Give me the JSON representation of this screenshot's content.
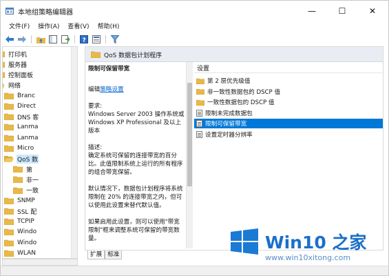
{
  "window": {
    "title": "本地组策略编辑器",
    "controls": {
      "minimize": "—",
      "maximize": "☐",
      "close": "✕"
    }
  },
  "menu": [
    "文件(F)",
    "操作(A)",
    "查看(V)",
    "帮助(H)"
  ],
  "toolbar": {
    "icons": [
      "back-arrow-icon",
      "forward-arrow-icon",
      "up-folder-icon",
      "console-tree-icon",
      "export-list-icon",
      "help-icon",
      "properties-icon",
      "filter-icon"
    ]
  },
  "tree": {
    "items": [
      {
        "label": "打印机",
        "arrow": "",
        "indent": 1
      },
      {
        "label": "服务器",
        "arrow": "",
        "indent": 1
      },
      {
        "label": "控制面板",
        "arrow": "›",
        "indent": 1
      },
      {
        "label": "网络",
        "arrow": "⌄",
        "indent": 1
      },
      {
        "label": "Branc",
        "arrow": "",
        "indent": 2
      },
      {
        "label": "Direct",
        "arrow": "",
        "indent": 2
      },
      {
        "label": "DNS 客",
        "arrow": "",
        "indent": 2
      },
      {
        "label": "Lanma",
        "arrow": "",
        "indent": 2
      },
      {
        "label": "Lanma",
        "arrow": "",
        "indent": 2
      },
      {
        "label": "Micro",
        "arrow": "›",
        "indent": 2
      },
      {
        "label": "QoS 数",
        "arrow": "⌄",
        "indent": 2,
        "selected": true
      },
      {
        "label": "第",
        "arrow": "",
        "indent": 3
      },
      {
        "label": "非一",
        "arrow": "",
        "indent": 3
      },
      {
        "label": "一致",
        "arrow": "",
        "indent": 3
      },
      {
        "label": "SNMP",
        "arrow": "",
        "indent": 2
      },
      {
        "label": "SSL 配",
        "arrow": "",
        "indent": 2
      },
      {
        "label": "TCPIP",
        "arrow": "›",
        "indent": 2
      },
      {
        "label": "Windo",
        "arrow": "",
        "indent": 2
      },
      {
        "label": "Windo",
        "arrow": "›",
        "indent": 2
      },
      {
        "label": "WLAN",
        "arrow": "›",
        "indent": 2
      }
    ]
  },
  "pane": {
    "header": "QoS 数据包计划程序",
    "description": {
      "title": "限制可保留带宽",
      "edit_prefix": "编辑",
      "edit_link": "策略设置",
      "requirements": "要求:\nWindows Server 2003 操作系统或 Windows XP Professional 及以上版本",
      "desc": "描述:\n确定系统可保留的连接带宽的百分比。此值限制系统上运行的所有程序的组合带宽保留。",
      "default": "默认情况下，数据包计划程序将系统限制在 20% 的连接带宽之内，但可以使用此设置来替代默认值。",
      "enabled": "如果启用此设置，则可以使用\"带宽限制\"框来调整系统可保留的带宽数量。"
    },
    "list_header": "设置",
    "items": [
      {
        "label": "第 2 层优先级值",
        "type": "folder"
      },
      {
        "label": "非一致性数据包的 DSCP 值",
        "type": "folder"
      },
      {
        "label": "一致性数据包的 DSCP 值",
        "type": "folder"
      },
      {
        "label": "限制未完成数据包",
        "type": "setting"
      },
      {
        "label": "限制可保留带宽",
        "type": "setting",
        "selected": true
      },
      {
        "label": "设置定时器分辨率",
        "type": "setting"
      }
    ],
    "tabs": [
      "扩展",
      "标准"
    ]
  },
  "watermark": {
    "brand": "Win10 之家",
    "url": "www.win10xitong.com"
  },
  "colors": {
    "accent": "#0078d7",
    "folder": "#e8b94a",
    "selected_tree": "#cce8ff",
    "header_band": "#e9edf3",
    "watermark": "#1a6fc9"
  }
}
